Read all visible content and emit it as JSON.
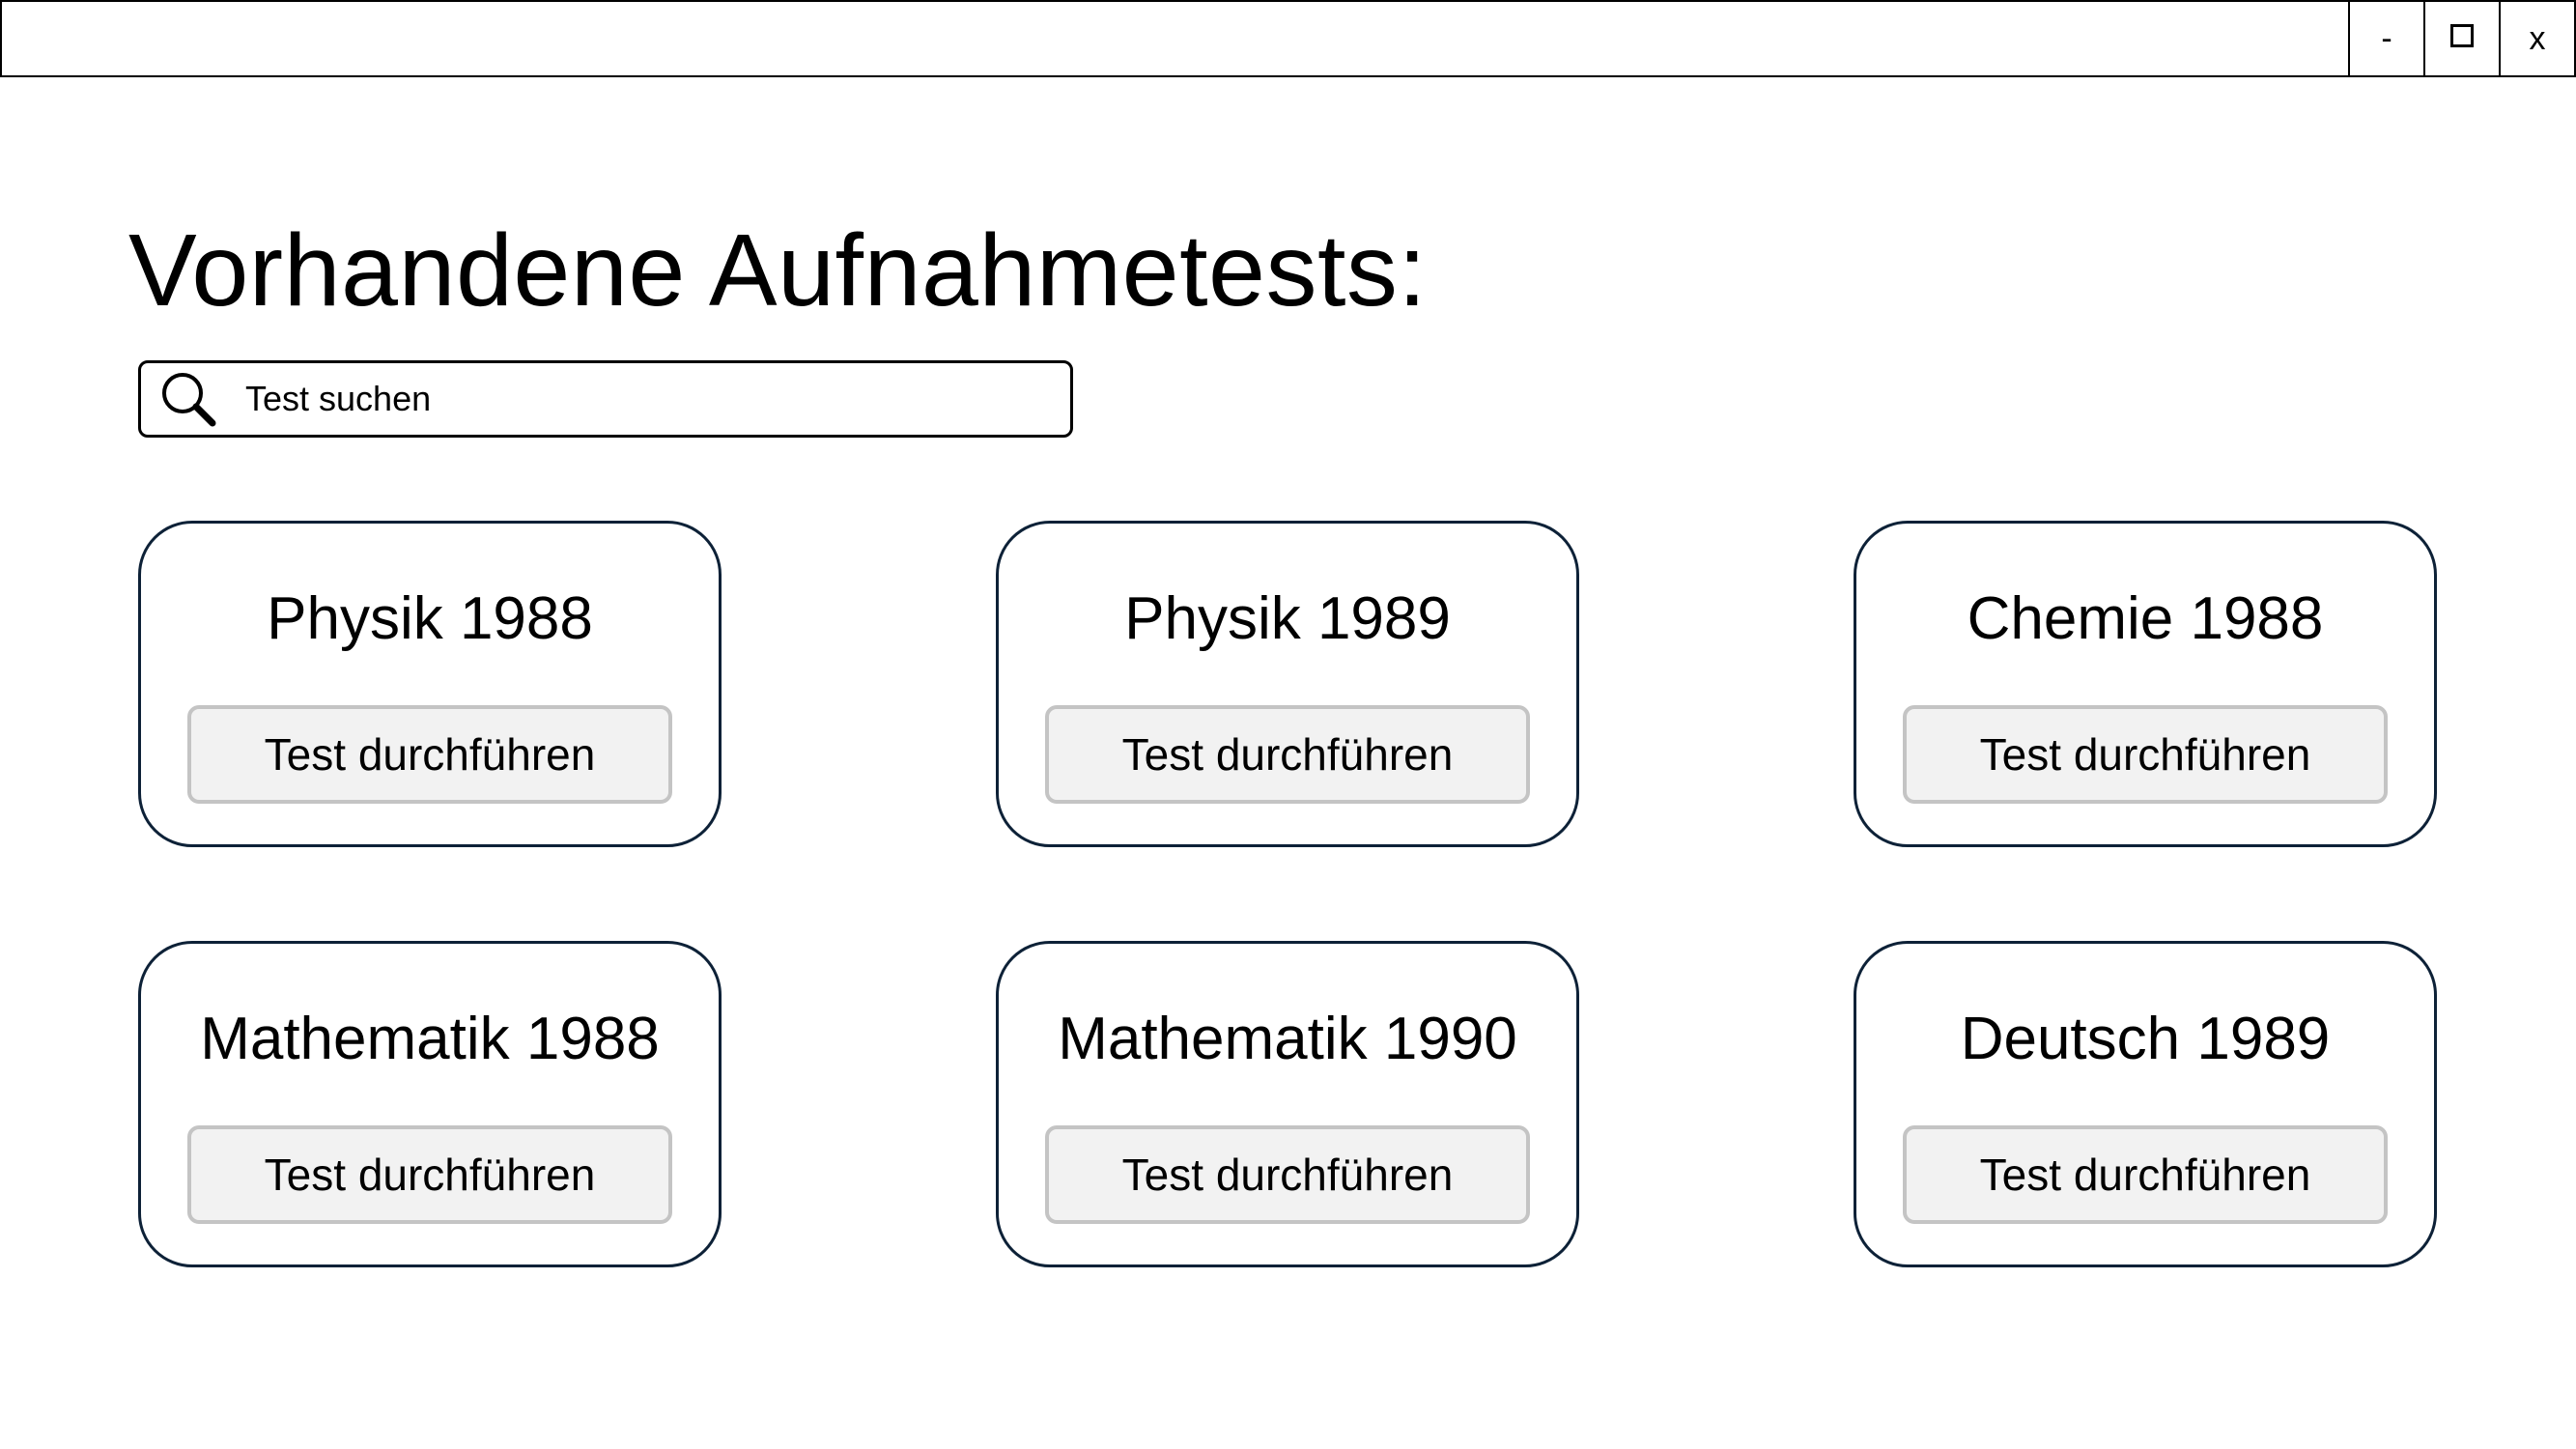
{
  "window": {
    "controls": {
      "minimize": "-",
      "close": "x"
    }
  },
  "page": {
    "title": "Vorhandene Aufnahmetests:"
  },
  "search": {
    "placeholder": "Test suchen"
  },
  "cards": [
    {
      "title": "Physik 1988",
      "button": "Test durchführen"
    },
    {
      "title": "Physik 1989",
      "button": "Test durchführen"
    },
    {
      "title": "Chemie 1988",
      "button": "Test durchführen"
    },
    {
      "title": "Mathematik 1988",
      "button": "Test durchführen"
    },
    {
      "title": "Mathematik 1990",
      "button": "Test durchführen"
    },
    {
      "title": "Deutsch 1989",
      "button": "Test durchführen"
    }
  ]
}
